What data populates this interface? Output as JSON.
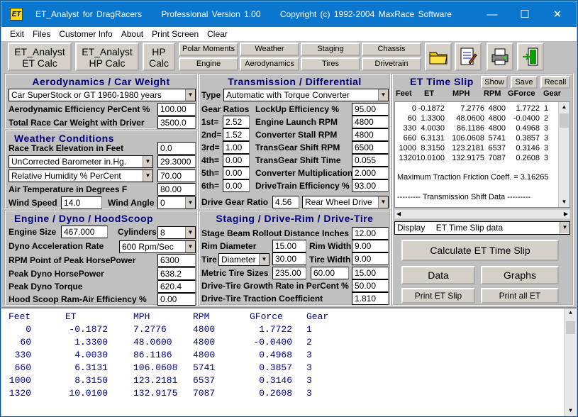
{
  "window": {
    "title_parts": [
      "ET_Analyst  for  DragRacers",
      "Professional  Version  1.00",
      "Copyright (c) 1992-2004  MaxRace Software"
    ],
    "icon_text": "ET",
    "min": "—",
    "max": "☐",
    "close": "✕"
  },
  "menu": [
    "Exit",
    "Files",
    "Customer Info",
    "About",
    "Print Screen",
    "Clear"
  ],
  "toolbar": {
    "big": [
      {
        "l1": "ET_Analyst",
        "l2": "ET  Calc"
      },
      {
        "l1": "ET_Analyst",
        "l2": "HP  Calc"
      },
      {
        "l1": "HP",
        "l2": "Calc"
      }
    ],
    "small": [
      "Polar Moments",
      "Weather",
      "Staging",
      "Chassis",
      "Engine",
      "Aerodynamics",
      "Tires",
      "Drivetrain"
    ]
  },
  "aero": {
    "title": "Aerodynamics  /  Car Weight",
    "car_type": "Car  SuperStock  or  GT  1960-1980 years",
    "efficiency_label": "Aerodynamic  Efficiency  PerCent  %",
    "efficiency": "100.00",
    "weight_label": "Total Race Car Weight  with  Driver",
    "weight": "3500.0"
  },
  "weather": {
    "title": "Weather  Conditions",
    "elevation_label": "Race Track Elevation   in  Feet",
    "elevation": "0.0",
    "barometer_type": "UnCorrected Barometer  in.Hg.",
    "barometer": "29.3000",
    "humidity_type": "Relative Humidity  %  PerCent",
    "humidity": "70.00",
    "temp_label": "Air Temperature  in  Degrees  F",
    "temp": "80.00",
    "wind_speed_label": "Wind Speed",
    "wind_speed": "14.0",
    "wind_angle_label": "Wind Angle",
    "wind_angle": "0"
  },
  "engine": {
    "title": "Engine  /  Dyno  /  HoodScoop",
    "size_label": "Engine Size",
    "size": "467.000",
    "cyl_label": "Cylinders",
    "cyl": "8",
    "accel_label": "Dyno  Acceleration  Rate",
    "accel": "600 Rpm/Sec",
    "rpm_peak_label": "RPM  Point  of  Peak  HorsePower",
    "rpm_peak": "6300",
    "peak_hp_label": "Peak  Dyno  HorsePower",
    "peak_hp": "638.2",
    "peak_tq_label": "Peak  Dyno  Torque",
    "peak_tq": "620.4",
    "scoop_label": "Hood Scoop  Ram-Air  Efficiency %",
    "scoop": "0.00"
  },
  "trans": {
    "title": "Transmission  /  Differential",
    "type_label": "Type",
    "type": "Automatic with Torque Converter",
    "ratios_label": "Gear Ratios",
    "gears": [
      {
        "label": "1st=",
        "value": "2.52"
      },
      {
        "label": "2nd=",
        "value": "1.52"
      },
      {
        "label": "3rd=",
        "value": "1.00"
      },
      {
        "label": "4th=",
        "value": "0.00"
      },
      {
        "label": "5th=",
        "value": "0.00"
      },
      {
        "label": "6th=",
        "value": "0.00"
      }
    ],
    "params": [
      {
        "label": "LockUp Efficiency %",
        "value": "95.00"
      },
      {
        "label": "Engine Launch RPM",
        "value": "4800"
      },
      {
        "label": "Converter Stall RPM",
        "value": "4800"
      },
      {
        "label": "TransGear Shift RPM",
        "value": "6500"
      },
      {
        "label": "TransGear Shift Time",
        "value": "0.055"
      },
      {
        "label": "Converter Multiplication",
        "value": "2.000"
      },
      {
        "label": "DriveTrain Efficiency %",
        "value": "93.00"
      }
    ],
    "drive_ratio_label": "Drive Gear Ratio",
    "drive_ratio": "4.56",
    "drive_type": "Rear Wheel Drive"
  },
  "staging": {
    "title": "Staging  /  Drive-Rim  /  Drive-Tire",
    "rollout_label": "Stage Beam Rollout Distance Inches",
    "rollout": "12.00",
    "rim_dia_label": "Rim  Diameter",
    "rim_dia": "15.00",
    "rim_width_label": "Rim Width",
    "rim_width": "9.00",
    "tire_label": "Tire",
    "tire_mode": "Diameter",
    "tire_dia": "30.00",
    "tire_width_label": "Tire Width",
    "tire_width": "9.00",
    "metric_label": "Metric Tire Sizes",
    "metric_a": "235.00",
    "metric_b": "60.00",
    "metric_c": "15.00",
    "growth_label": "Drive-Tire Growth Rate in PerCent %",
    "growth": "50.00",
    "traction_label": "Drive-Tire Traction Coefficient",
    "traction": "1.810"
  },
  "slip": {
    "title": "ET  Time  Slip",
    "show": "Show",
    "save": "Save",
    "recall": "Recall",
    "headers": [
      "Feet",
      "ET",
      "MPH",
      "RPM",
      "GForce",
      "Gear"
    ],
    "rows": [
      [
        "0",
        "-0.1872",
        "7.2776",
        "4800",
        "1.7722",
        "1"
      ],
      [
        "60",
        "1.3300",
        "48.0600",
        "4800",
        "-0.0400",
        "2"
      ],
      [
        "330",
        "4.0030",
        "86.1186",
        "4800",
        "0.4968",
        "3"
      ],
      [
        "660",
        "6.3131",
        "106.0608",
        "5741",
        "0.3857",
        "3"
      ],
      [
        "1000",
        "8.3150",
        "123.2181",
        "6537",
        "0.3146",
        "3"
      ],
      [
        "1320",
        "10.0100",
        "132.9175",
        "7087",
        "0.2608",
        "3"
      ]
    ],
    "friction": "Maximum Traction Friction Coeff. = 3.16265",
    "shift_data": "--------- Transmission   Shift   Data ---------",
    "display_label": "Display",
    "display_value": "ET  Time  Slip  data"
  },
  "actions": {
    "calc": "Calculate  ET  Time  Slip",
    "data": "Data",
    "graphs": "Graphs",
    "print_slip": "Print ET Slip",
    "print_all": "Print  all  ET"
  },
  "output": {
    "headers": [
      "Feet",
      "ET",
      "MPH",
      "RPM",
      "GForce",
      "Gear"
    ],
    "rows": [
      [
        "0",
        "-0.1872",
        "7.2776",
        "4800",
        "1.7722",
        "1"
      ],
      [
        "60",
        "1.3300",
        "48.0600",
        "4800",
        "-0.0400",
        "2"
      ],
      [
        "330",
        "4.0030",
        "86.1186",
        "4800",
        "0.4968",
        "3"
      ],
      [
        "660",
        "6.3131",
        "106.0608",
        "5741",
        "0.3857",
        "3"
      ],
      [
        "1000",
        "8.3150",
        "123.2181",
        "6537",
        "0.3146",
        "3"
      ],
      [
        "1320",
        "10.0100",
        "132.9175",
        "7087",
        "0.2608",
        "3"
      ]
    ]
  }
}
